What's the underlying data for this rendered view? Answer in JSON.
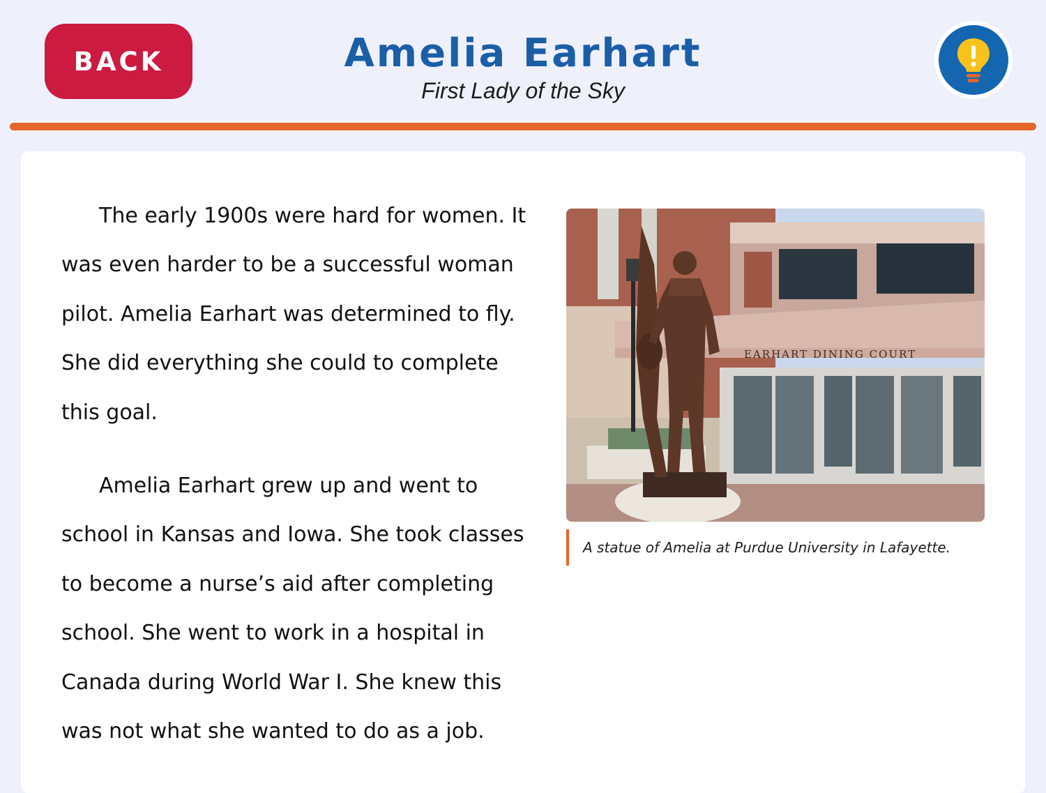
{
  "header": {
    "back_label": "BACK",
    "title": "Amelia Earhart",
    "subtitle": "First Lady of the Sky",
    "hint_icon": "lightbulb-icon"
  },
  "article": {
    "paragraphs": [
      "The early 1900s were hard for women. It was even harder to be a successful woman pilot. Amelia Earhart was determined to fly. She did everything she could to complete this goal.",
      "Amelia Earhart grew up and went to school in Kansas and Iowa. She took classes to become a nurse’s aid after completing school. She went to work in a hospital in Canada during World War I. She knew this was not what she wanted to do as a job."
    ]
  },
  "figure": {
    "sign_text": "EARHART DINING COURT",
    "caption": "A statue of Amelia at Purdue University in Lafayette."
  },
  "colors": {
    "background": "#eef1fc",
    "back_button": "#cc1a40",
    "title": "#1b5ea8",
    "accent_line": "#e5662a",
    "hint_button": "#1466b0",
    "lightbulb": "#f7c21b"
  }
}
